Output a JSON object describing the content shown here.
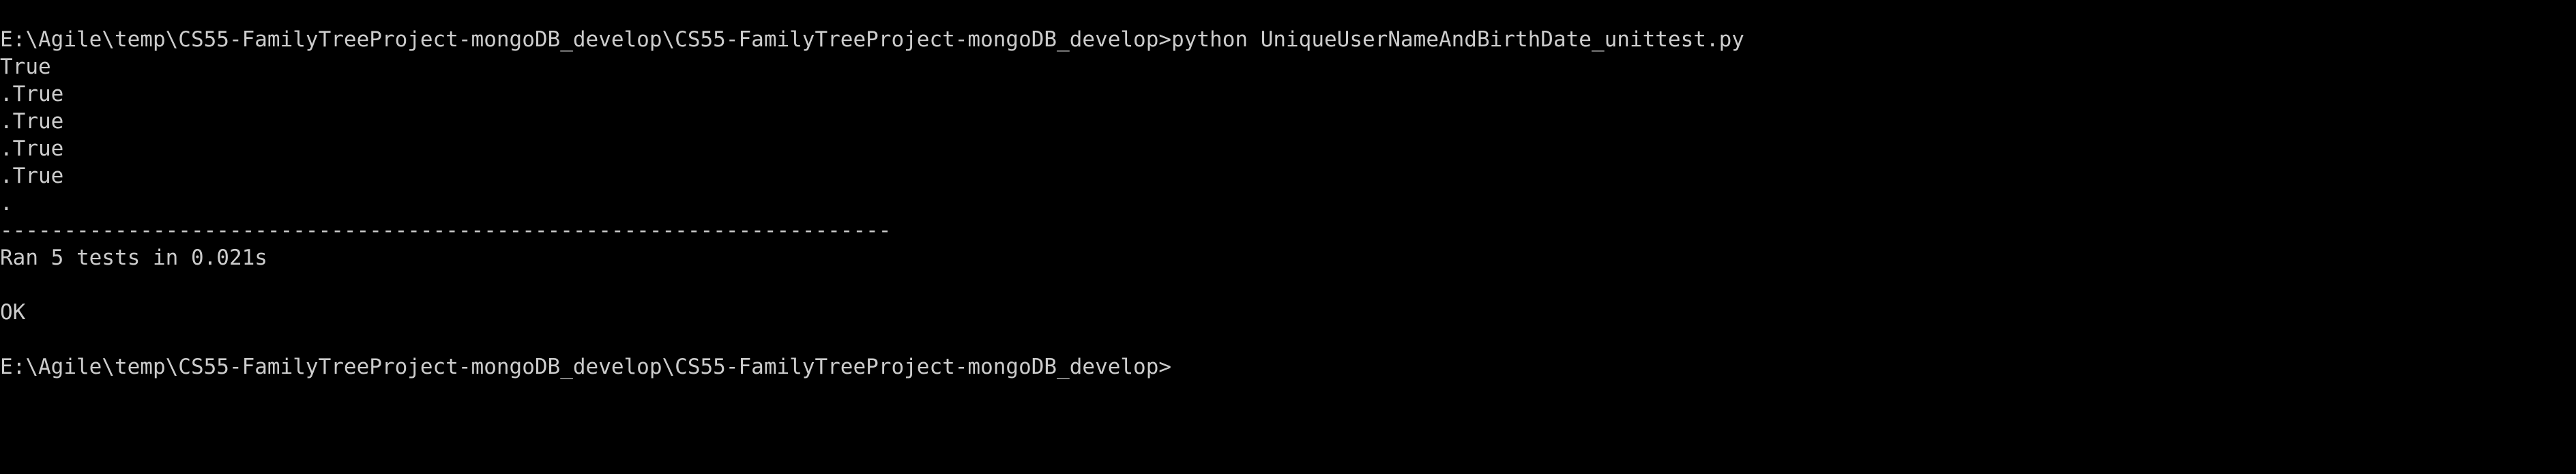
{
  "terminal": {
    "lines": [
      "E:\\Agile\\temp\\CS55-FamilyTreeProject-mongoDB_develop\\CS55-FamilyTreeProject-mongoDB_develop>python UniqueUserNameAndBirthDate_unittest.py",
      "True",
      ".True",
      ".True",
      ".True",
      ".True",
      ".",
      "----------------------------------------------------------------------",
      "Ran 5 tests in 0.021s",
      "",
      "OK",
      "",
      "E:\\Agile\\temp\\CS55-FamilyTreeProject-mongoDB_develop\\CS55-FamilyTreeProject-mongoDB_develop>"
    ]
  },
  "colors": {
    "background": "#000000",
    "foreground": "#cccccc"
  }
}
